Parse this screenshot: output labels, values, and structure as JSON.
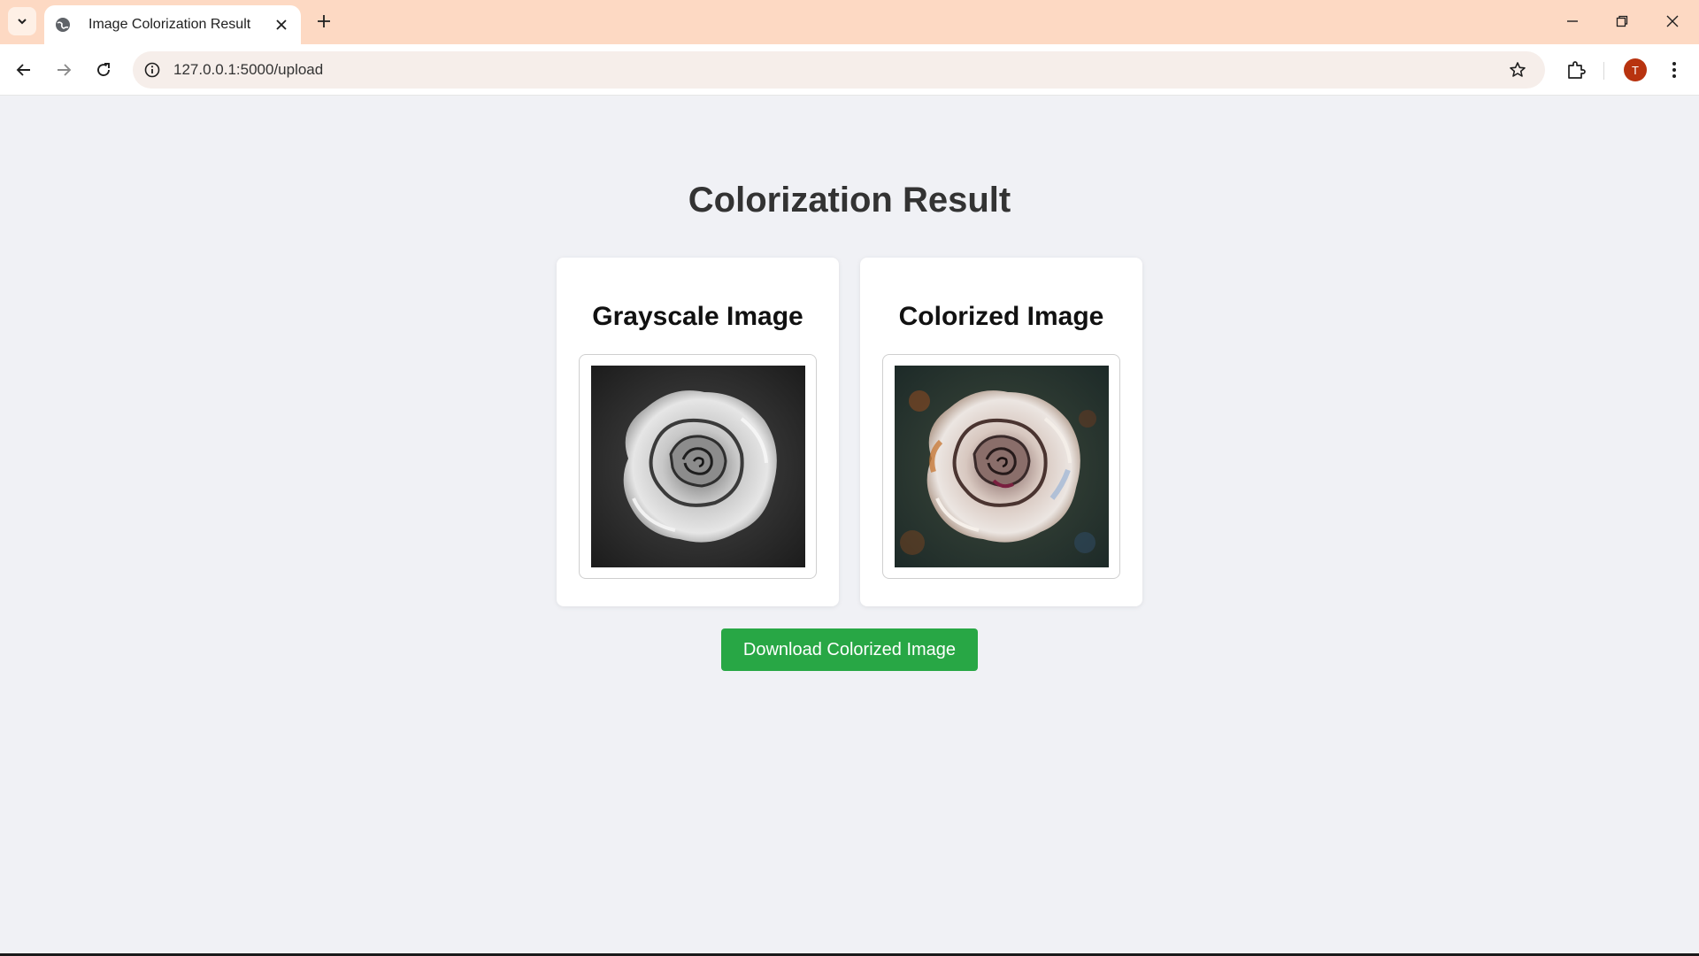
{
  "browser": {
    "tab_title": "Image Colorization Result",
    "url": "127.0.0.1:5000/upload",
    "profile_initial": "T",
    "profile_color": "#b8330f"
  },
  "page": {
    "title": "Colorization Result",
    "cards": [
      {
        "title": "Grayscale Image",
        "image_name": "grayscale-rose-image"
      },
      {
        "title": "Colorized Image",
        "image_name": "colorized-rose-image"
      }
    ],
    "download_label": "Download Colorized Image",
    "download_color": "#28a745"
  }
}
